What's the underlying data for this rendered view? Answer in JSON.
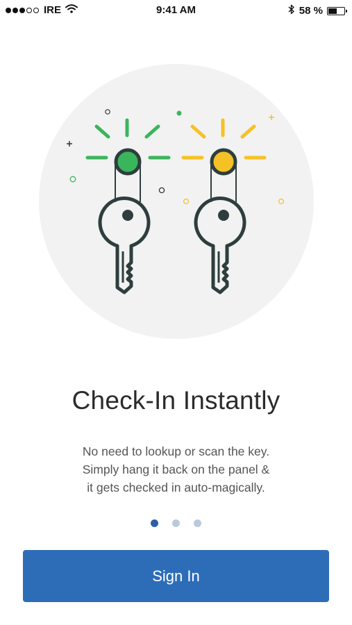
{
  "status_bar": {
    "carrier": "IRE",
    "time": "9:41 AM",
    "battery_percent": "58 %",
    "battery_level": 0.58,
    "signal_strength": 3,
    "signal_max": 5,
    "icons": [
      "wifi-icon",
      "bluetooth-icon",
      "battery-icon"
    ]
  },
  "onboarding": {
    "illustration": {
      "description_icons": [
        "key-icon",
        "key-icon"
      ],
      "colors": {
        "green": "#3bb55c",
        "yellow": "#f6c125",
        "key_stroke": "#2e3e3e",
        "background_circle": "#f2f2f2"
      }
    },
    "title": "Check-In Instantly",
    "description_lines": [
      "No need to lookup or scan the key.",
      "Simply hang it back on the panel &",
      "it gets checked in auto-magically."
    ],
    "pager": {
      "count": 3,
      "active_index": 0
    }
  },
  "actions": {
    "sign_in_label": "Sign In"
  },
  "colors": {
    "primary": "#2d6db8",
    "pager_active": "#2d5fa8",
    "pager_inactive": "#b9c9de",
    "title_text": "#2b2b2b",
    "body_text": "#555555"
  }
}
